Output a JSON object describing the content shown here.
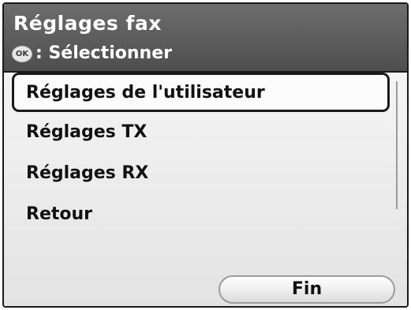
{
  "header": {
    "title": "Réglages fax",
    "hint_icon": "OK",
    "hint_text": ": Sélectionner"
  },
  "menu": {
    "items": [
      {
        "label": "Réglages de l'utilisateur",
        "selected": true
      },
      {
        "label": "Réglages TX",
        "selected": false
      },
      {
        "label": "Réglages RX",
        "selected": false
      },
      {
        "label": "Retour",
        "selected": false
      }
    ]
  },
  "footer": {
    "fin_label": "Fin"
  },
  "colors": {
    "header_bg": "#5a5a5a",
    "list_bg": "#ececec",
    "text": "#111111"
  }
}
